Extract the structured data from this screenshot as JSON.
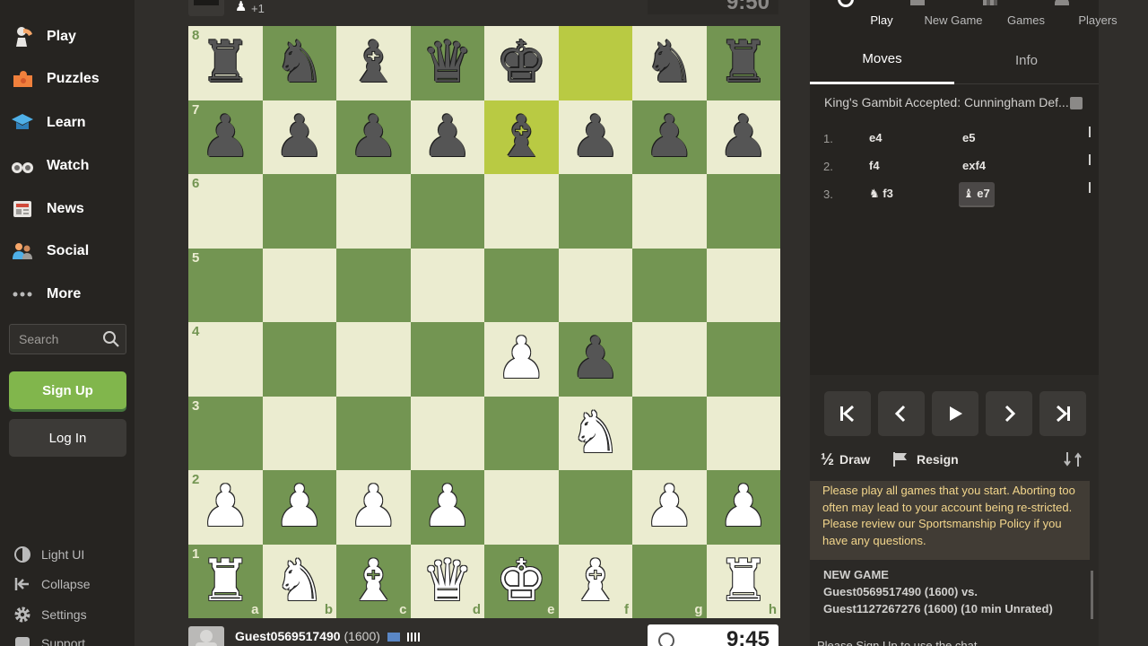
{
  "sidebar": {
    "nav": [
      {
        "label": "Play",
        "icon": "pawn-hand-icon"
      },
      {
        "label": "Puzzles",
        "icon": "puzzle-icon"
      },
      {
        "label": "Learn",
        "icon": "graduation-cap-icon"
      },
      {
        "label": "Watch",
        "icon": "binoculars-icon"
      },
      {
        "label": "News",
        "icon": "newspaper-icon"
      },
      {
        "label": "Social",
        "icon": "people-icon"
      },
      {
        "label": "More",
        "icon": "ellipsis-icon"
      }
    ],
    "search_placeholder": "Search",
    "signup_label": "Sign Up",
    "login_label": "Log In",
    "bottom": [
      {
        "label": "Light UI",
        "icon": "contrast-icon"
      },
      {
        "label": "Collapse",
        "icon": "collapse-arrow-icon"
      },
      {
        "label": "Settings",
        "icon": "gear-icon"
      },
      {
        "label": "Support",
        "icon": "support-icon"
      }
    ]
  },
  "top_player": {
    "material": "+1",
    "clock": "9:50"
  },
  "bottom_player": {
    "name": "Guest0569517490",
    "rating": "(1600)",
    "clock": "9:45"
  },
  "board": {
    "ranks": [
      "8",
      "7",
      "6",
      "5",
      "4",
      "3",
      "2",
      "1"
    ],
    "files": [
      "a",
      "b",
      "c",
      "d",
      "e",
      "f",
      "g",
      "h"
    ],
    "position": [
      [
        "bR",
        "bN",
        "bB",
        "bQ",
        "bK",
        "",
        "bN",
        "bR"
      ],
      [
        "bP",
        "bP",
        "bP",
        "bP",
        "bB",
        "bP",
        "bP",
        "bP"
      ],
      [
        "",
        "",
        "",
        "",
        "",
        "",
        "",
        ""
      ],
      [
        "",
        "",
        "",
        "",
        "",
        "",
        "",
        ""
      ],
      [
        "",
        "",
        "",
        "",
        "wP",
        "bP",
        "",
        ""
      ],
      [
        "",
        "",
        "",
        "",
        "",
        "wN",
        "",
        ""
      ],
      [
        "wP",
        "wP",
        "wP",
        "wP",
        "",
        "",
        "wP",
        "wP"
      ],
      [
        "wR",
        "wN",
        "wB",
        "wQ",
        "wK",
        "wB",
        "",
        "wR"
      ]
    ],
    "highlighted": [
      "f8",
      "e7"
    ]
  },
  "panel": {
    "tabs": [
      {
        "label": "Play",
        "icon": "play-icon"
      },
      {
        "label": "New Game",
        "icon": "plus-icon"
      },
      {
        "label": "Games",
        "icon": "board-icon"
      },
      {
        "label": "Players",
        "icon": "players-icon"
      }
    ],
    "subtabs": [
      "Moves",
      "Info"
    ],
    "opening": "King's Gambit Accepted: Cunningham Def...",
    "moves": [
      {
        "num": "1.",
        "white": "e4",
        "black": "e5"
      },
      {
        "num": "2.",
        "white": "f4",
        "black": "exf4"
      },
      {
        "num": "3.",
        "white": "f3",
        "black": "e7",
        "white_piece": "♞",
        "black_piece": "♝"
      }
    ],
    "draw_label": "Draw",
    "draw_icon_text": "½",
    "resign_label": "Resign",
    "notice": "Please play all games that you start. Aborting too often may lead to your account being re-stricted. Please review our Sportsmanship Policy if you have any questions.",
    "newgame_heading": "NEW GAME",
    "newgame_line1": "Guest0569517490 (1600) vs.",
    "newgame_line2": "Guest1127267276 (1600) (10 min Unrated)",
    "bottom_text": "Please Sign Up to use the chat"
  }
}
